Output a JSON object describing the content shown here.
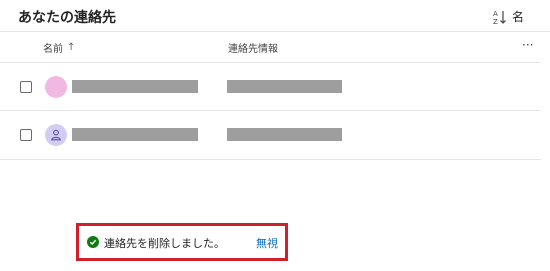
{
  "header": {
    "title": "あなたの連絡先",
    "sort_label": "名"
  },
  "columns": {
    "name": "名前",
    "name_sort_arrow": "↑",
    "contact_info": "連絡先情報",
    "more": "···"
  },
  "contacts": [
    {
      "avatar": "pink-circle",
      "name_redacted": true,
      "info_redacted": true
    },
    {
      "avatar": "person-icon",
      "name_redacted": true,
      "info_redacted": true
    }
  ],
  "toast": {
    "message": "連絡先を削除しました。",
    "action": "無視",
    "icon": "success-check-icon",
    "highlight_color": "#d0202b"
  },
  "colors": {
    "accent": "#0f6cbd",
    "success": "#107c10"
  }
}
